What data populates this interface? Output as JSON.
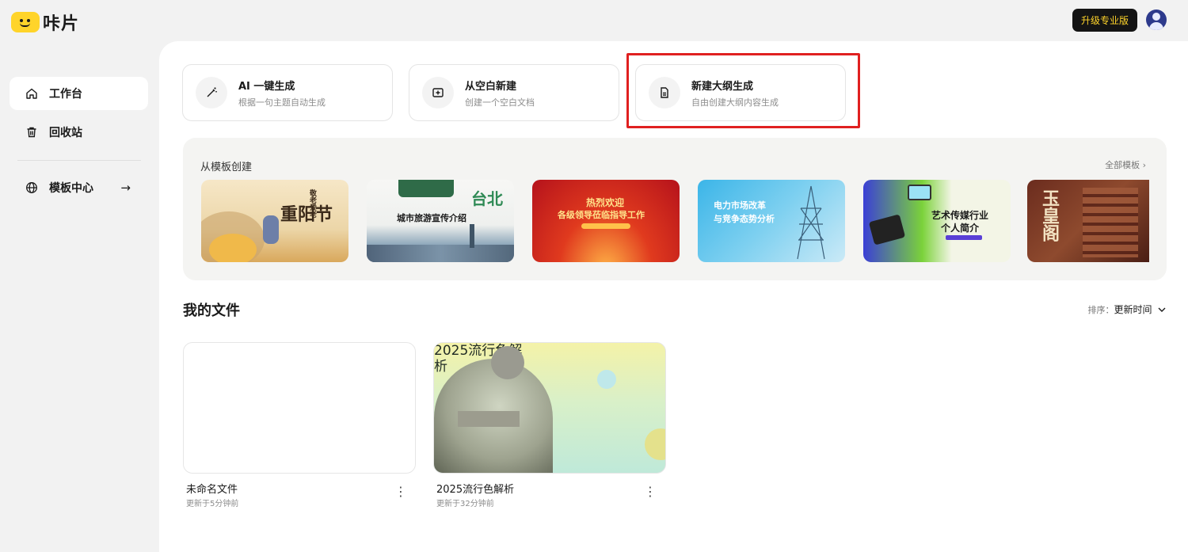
{
  "app": {
    "name": "咔片"
  },
  "header": {
    "upgrade_label": "升级专业版"
  },
  "sidebar": {
    "items": [
      {
        "label": "工作台",
        "icon": "home-icon",
        "active": true
      },
      {
        "label": "回收站",
        "icon": "trash-icon"
      },
      {
        "label": "模板中心",
        "icon": "globe-icon"
      }
    ],
    "arrow": "→"
  },
  "actions": [
    {
      "title": "AI 一键生成",
      "subtitle": "根据一句主题自动生成",
      "icon": "magic-wand-icon"
    },
    {
      "title": "从空白新建",
      "subtitle": "创建一个空白文档",
      "icon": "add-slide-icon"
    },
    {
      "title": "新建大纲生成",
      "subtitle": "自由创建大纲内容生成",
      "icon": "document-icon"
    }
  ],
  "templates": {
    "title": "从模板创建",
    "all_label": "全部模板 ›",
    "items": [
      {
        "text": "重阳节",
        "sub": "敬老爱老"
      },
      {
        "text": "城市旅游宣传介绍",
        "sub": "台北"
      },
      {
        "text": "热烈欢迎",
        "sub": "各级领导莅临指导工作"
      },
      {
        "text": "电力市场改革",
        "sub": "与竞争态势分析"
      },
      {
        "text": "艺术传媒行业",
        "sub": "个人简介"
      },
      {
        "text": "玉皇阁",
        "sub": ""
      }
    ]
  },
  "files": {
    "title": "我的文件",
    "sort_label": "排序：",
    "sort_value": "更新时间",
    "items": [
      {
        "name": "未命名文件",
        "time": "更新于5分钟前",
        "cover": ""
      },
      {
        "name": "2025流行色解析",
        "time": "更新于32分钟前",
        "cover": "2025流行色解析"
      }
    ]
  },
  "colors": {
    "accent": "#ffd42a",
    "highlight": "#e02020",
    "upgrade_bg": "#141414"
  }
}
